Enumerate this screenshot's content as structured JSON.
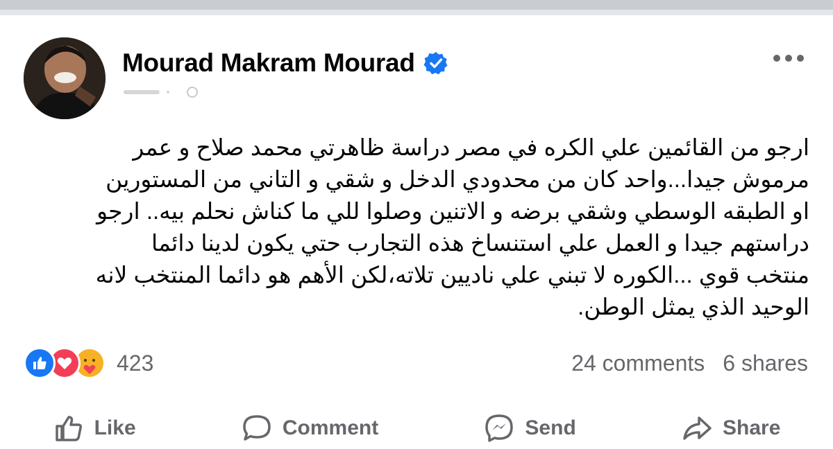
{
  "post": {
    "author": "Mourad Makram Mourad",
    "verified": true,
    "text": "ارجو من القائمين علي الكره في مصر دراسة ظاهرتي محمد صلاح و عمر\nمرموش جيدا...واحد كان من محدودي الدخل و شقي و التاني من المستورين\nاو الطبقه الوسطي وشقي برضه و الاتنين وصلوا للي ما كناش نحلم بيه.. ارجو\nدراستهم جيدا و العمل علي استنساخ هذه التجارب حتي يكون لدينا دائما\nمنتخب قوي ...الكوره لا تبني علي ناديين تلاته،لكن الأهم هو دائما المنتخب لانه\nالوحيد الذي يمثل الوطن."
  },
  "reactions": {
    "count": "423",
    "icons": [
      "like-icon",
      "love-icon",
      "care-icon"
    ]
  },
  "stats": {
    "comments": "24 comments",
    "shares": "6 shares"
  },
  "actions": {
    "like": "Like",
    "comment": "Comment",
    "send": "Send",
    "share": "Share"
  },
  "colors": {
    "accent": "#1877f2",
    "love": "#f33e58",
    "care": "#f7b125",
    "secondary_text": "#65676b",
    "divider": "#c9ccd1"
  }
}
